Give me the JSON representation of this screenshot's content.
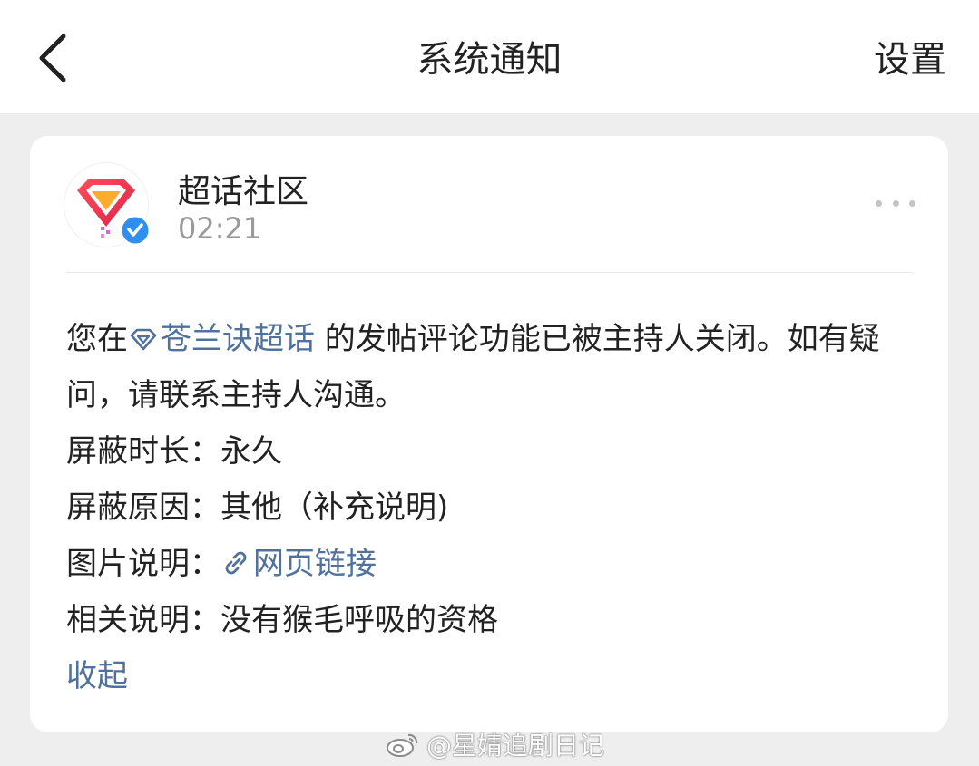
{
  "header": {
    "title": "系统通知",
    "settings_label": "设置"
  },
  "post": {
    "author": "超话社区",
    "time": "02:21",
    "message_prefix": "您在",
    "topic_link": "苍兰诀超话",
    "message_suffix": " 的发帖评论功能已被主持人关闭。如有疑问，请联系主持人沟通。",
    "fields": [
      {
        "label": "屏蔽时长：",
        "value": "永久"
      },
      {
        "label": "屏蔽原因：",
        "value": "其他（补充说明)"
      },
      {
        "label": "图片说明：",
        "link": "网页链接"
      },
      {
        "label": "相关说明：",
        "value": "没有猴毛呼吸的资格"
      }
    ],
    "collapse_label": "收起"
  },
  "watermark": "@星婧追剧日记",
  "colors": {
    "link": "#50719c",
    "background": "#eeeeee",
    "card": "#ffffff",
    "muted": "#9a9a9a",
    "verified": "#2f8ff0",
    "logo_red": "#f03a3a",
    "logo_orange": "#ffab2e"
  },
  "icons": {
    "back": "chevron-left-icon",
    "more": "more-dots-icon",
    "topic": "diamond-icon",
    "link": "chain-link-icon",
    "verified": "verified-check-icon",
    "watermark": "weibo-logo-icon"
  }
}
